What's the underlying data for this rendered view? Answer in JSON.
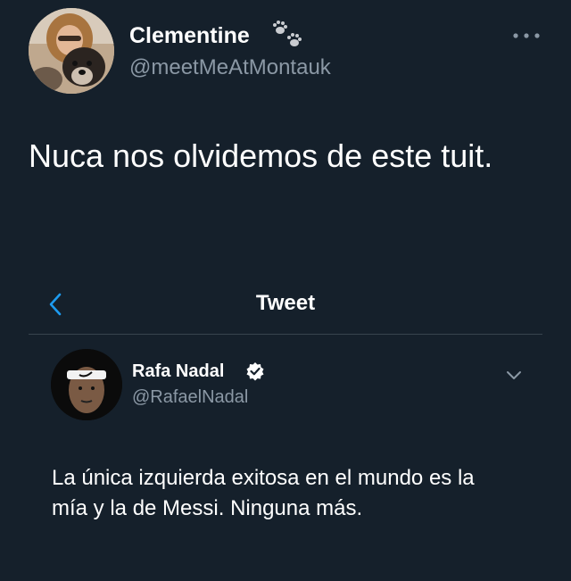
{
  "tweet": {
    "author_name": "Clementine",
    "author_handle": "@meetMeAtMontauk",
    "text": "Nuca nos olvidemos de este tuit.",
    "name_emoji_icon": "paw-prints-icon",
    "more_icon": "more-horizontal-icon"
  },
  "embedded_screenshot": {
    "header_title": "Tweet",
    "back_icon": "chevron-left-icon",
    "author_name": "Rafa Nadal",
    "author_handle": "@RafaelNadal",
    "verified_icon": "verified-badge-icon",
    "caret_icon": "chevron-down-icon",
    "text": "La única izquierda exitosa en el mundo es la mía y la de Messi. Ninguna más."
  },
  "colors": {
    "background": "#15202b",
    "secondary_text": "#8b98a5",
    "accent": "#1d9bf0",
    "divider": "#38444d"
  }
}
